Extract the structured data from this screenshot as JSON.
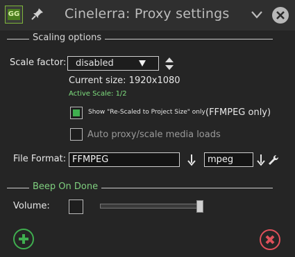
{
  "window": {
    "title": "Cinelerra: Proxy settings",
    "app_icon_text": "GG"
  },
  "scaling": {
    "section_label": "Scaling options",
    "scale_factor_label": "Scale factor:",
    "scale_factor_value": "disabled",
    "current_size": "Current size: 1920x1080",
    "active_scale": "Active Scale: 1/2",
    "show_rescaled_label": "Show \"Re-Scaled to Project Size\" only",
    "show_rescaled_checked": true,
    "ffmpeg_only": "(FFMPEG only)",
    "auto_proxy_label": "Auto proxy/scale media loads",
    "auto_proxy_checked": false,
    "file_format_label": "File Format:",
    "file_format_value": "FFMPEG",
    "codec_value": "mpeg"
  },
  "beep": {
    "section_label": "Beep On Done",
    "volume_label": "Volume:",
    "volume_checked": false,
    "volume_level": 1.0
  },
  "colors": {
    "accent_green": "#3fae4f",
    "label_green": "#7fd07f",
    "cancel_red": "#e0505a"
  },
  "icons": {
    "pin": "pin-icon",
    "chevron": "chevron-down-icon",
    "close": "close-icon",
    "updown": "up-down-arrows-icon",
    "down_arrow": "down-arrow-icon",
    "wrench": "wrench-icon",
    "ok": "plus-circle-icon",
    "cancel": "x-circle-icon"
  }
}
